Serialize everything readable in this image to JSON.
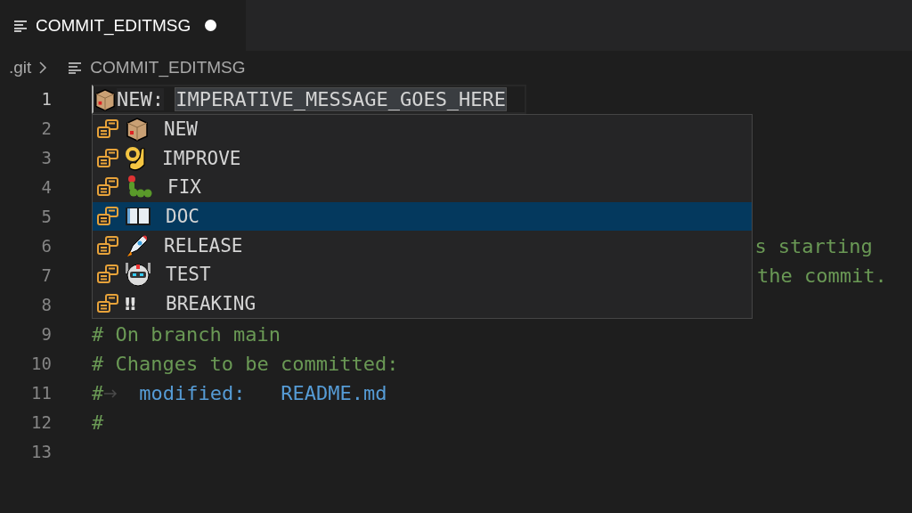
{
  "tab": {
    "title": "COMMIT_EDITMSG",
    "modified": true
  },
  "breadcrumb": {
    "folder": ".git",
    "file": "COMMIT_EDITMSG"
  },
  "lines": [
    {
      "number": "1",
      "current": true,
      "segments": [
        {
          "kind": "emoji"
        },
        {
          "kind": "plain",
          "text": "NEW:"
        },
        {
          "kind": "space"
        },
        {
          "kind": "placeholder",
          "text": "IMPERATIVE_MESSAGE_GOES_HERE"
        }
      ]
    },
    {
      "number": "2"
    },
    {
      "number": "3"
    },
    {
      "number": "4"
    },
    {
      "number": "5"
    },
    {
      "number": "6",
      "segments": [
        {
          "kind": "covered"
        },
        {
          "kind": "comment",
          "text": "s starting"
        }
      ]
    },
    {
      "number": "7",
      "segments": [
        {
          "kind": "covered"
        },
        {
          "kind": "comment",
          "text": "the commit."
        }
      ]
    },
    {
      "number": "8"
    },
    {
      "number": "9",
      "segments": [
        {
          "kind": "comment",
          "text": "# On branch main"
        }
      ]
    },
    {
      "number": "10",
      "segments": [
        {
          "kind": "comment",
          "text": "# Changes to be committed:"
        }
      ]
    },
    {
      "number": "11",
      "segments": [
        {
          "kind": "comment",
          "text": "#"
        },
        {
          "kind": "tab"
        },
        {
          "kind": "keyword",
          "text": "modified:   README.md"
        }
      ]
    },
    {
      "number": "12",
      "segments": [
        {
          "kind": "comment",
          "text": "#"
        }
      ]
    },
    {
      "number": "13"
    }
  ],
  "suggest": {
    "items": [
      {
        "label": "NEW",
        "selected": false
      },
      {
        "label": "IMPROVE",
        "selected": false
      },
      {
        "label": "FIX",
        "selected": false
      },
      {
        "label": "DOC",
        "selected": true
      },
      {
        "label": "RELEASE",
        "selected": false
      },
      {
        "label": "TEST",
        "selected": false
      },
      {
        "label": "BREAKING",
        "glyph": "‼",
        "selected": false
      }
    ]
  }
}
